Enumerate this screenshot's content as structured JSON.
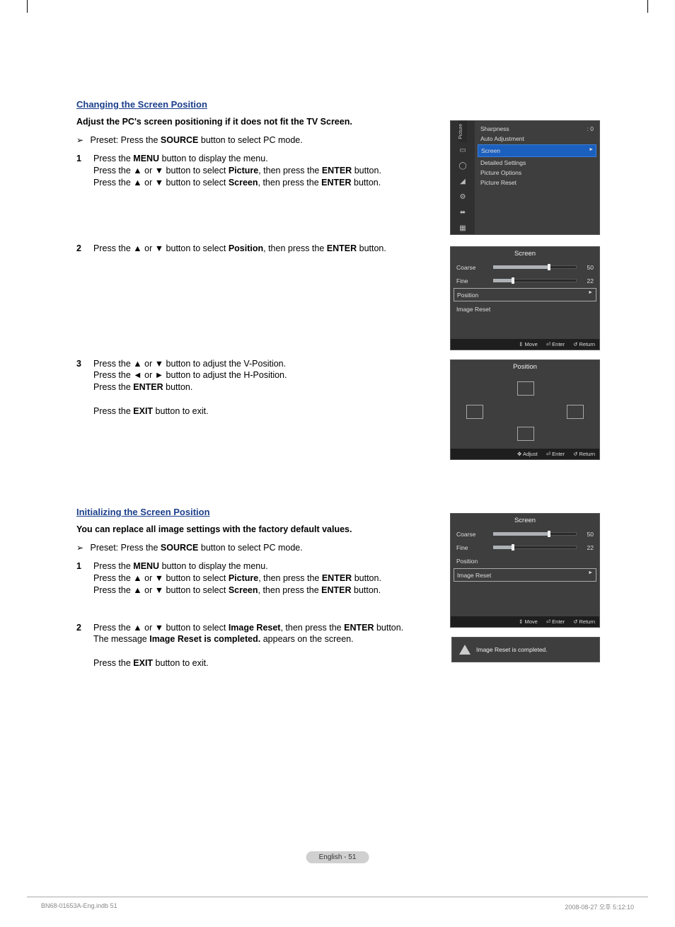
{
  "section1": {
    "heading": "Changing the Screen Position",
    "intro": "Adjust the PC's screen positioning if it does not fit the TV Screen.",
    "preset_pre": "Preset: Press the ",
    "preset_bold": "SOURCE",
    "preset_post": " button to select PC mode.",
    "step1_a": "Press the ",
    "step1_b": "MENU",
    "step1_c": " button to display the menu.",
    "step1_d": "Press the ▲ or ▼ button to select ",
    "step1_e": "Picture",
    "step1_f": ", then press the ",
    "step1_g": "ENTER",
    "step1_h": " button.",
    "step1_i": "Press the ▲ or ▼ button to select ",
    "step1_j": "Screen",
    "step1_k": ", then press the ",
    "step1_l": "ENTER",
    "step1_m": " button.",
    "step2_a": "Press the ▲ or ▼ button to select ",
    "step2_b": "Position",
    "step2_c": ", then press the ",
    "step2_d": "ENTER",
    "step2_e": " button.",
    "step3_a": "Press the ▲ or ▼ button to adjust the V-Position.",
    "step3_b": "Press the ◄ or ► button to adjust the H-Position.",
    "step3_c": "Press the ",
    "step3_d": "ENTER",
    "step3_e": " button.",
    "step3_f": "Press the ",
    "step3_g": "EXIT",
    "step3_h": " button to exit."
  },
  "section2": {
    "heading": "Initializing the Screen Position",
    "intro": "You can replace all image settings with the factory default values.",
    "preset_pre": "Preset: Press the ",
    "preset_bold": "SOURCE",
    "preset_post": " button to select PC mode.",
    "step1_a": "Press the ",
    "step1_b": "MENU",
    "step1_c": " button to display the menu.",
    "step1_d": "Press the ▲ or ▼ button to select ",
    "step1_e": "Picture",
    "step1_f": ", then press the ",
    "step1_g": "ENTER",
    "step1_h": " button.",
    "step1_i": "Press the ▲ or ▼ button to select ",
    "step1_j": "Screen",
    "step1_k": ", then press the ",
    "step1_l": "ENTER",
    "step1_m": " button.",
    "step2_a": "Press the ▲ or ▼ button to select ",
    "step2_b": "Image Reset",
    "step2_c": ", then press the ",
    "step2_d": "ENTER",
    "step2_e": " button.",
    "step2_f": "The message ",
    "step2_g": "Image Reset is completed.",
    "step2_h": " appears on the screen.",
    "step2_i": "Press the ",
    "step2_j": "EXIT",
    "step2_k": " button to exit."
  },
  "osd1": {
    "tab": "Picture",
    "sharpness": "Sharpness",
    "sharpness_val": ": 0",
    "auto_adjust": "Auto Adjustment",
    "screen": "Screen",
    "detailed": "Detailed Settings",
    "options": "Picture Options",
    "reset": "Picture Reset"
  },
  "osd_screen": {
    "title": "Screen",
    "coarse": "Coarse",
    "coarse_val": "50",
    "fine": "Fine",
    "fine_val": "22",
    "position": "Position",
    "image_reset": "Image Reset"
  },
  "osd_position": {
    "title": "Position"
  },
  "osd_footer": {
    "move": "Move",
    "enter": "Enter",
    "return": "Return",
    "adjust": "Adjust"
  },
  "osd_msg": {
    "text": "Image Reset is completed."
  },
  "page_footer": {
    "pageno": "English - 51",
    "file": "BN68-01653A-Eng.indb   51",
    "date": "2008-08-27   오후 5:12:10"
  }
}
